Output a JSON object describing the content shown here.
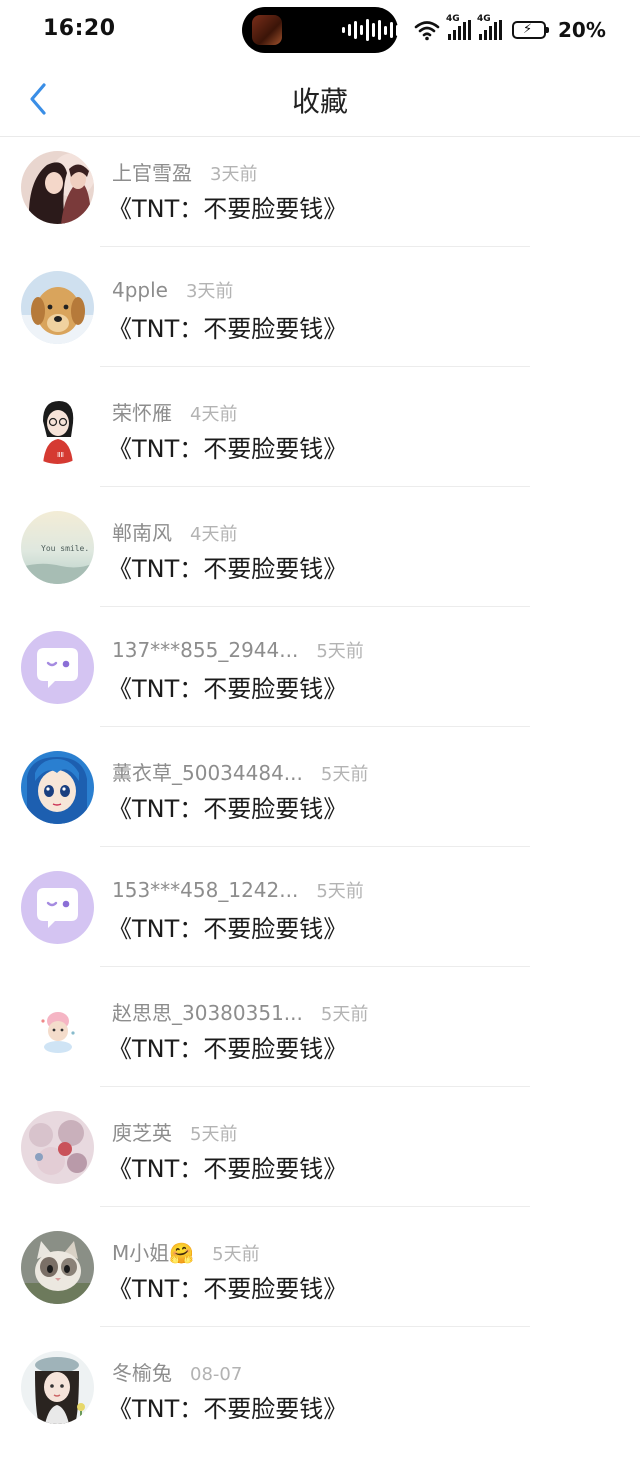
{
  "status_bar": {
    "time": "16:20",
    "network_1": "4G",
    "network_2": "4G",
    "battery": "20%"
  },
  "header": {
    "title": "收藏",
    "back_icon": "chevron-left-icon"
  },
  "colors": {
    "accent": "#3a8ee6",
    "name": "#8d8d8d",
    "time": "#b3b3b3",
    "default_avatar": "#d4c4f2"
  },
  "items": [
    {
      "name": "上官雪盈",
      "time": "3天前",
      "content": "《TNT：不要脸要钱》",
      "avatar": "avatar-couple-art"
    },
    {
      "name": "4pple",
      "time": "3天前",
      "content": "《TNT：不要脸要钱》",
      "avatar": "avatar-golden-dog"
    },
    {
      "name": "荣怀雁",
      "time": "4天前",
      "content": "《TNT：不要脸要钱》",
      "avatar": "avatar-cartoon-girl"
    },
    {
      "name": "郸南风",
      "time": "4天前",
      "content": "《TNT：不要脸要钱》",
      "avatar": "avatar-you-smile"
    },
    {
      "name": "137***855_2944...",
      "time": "5天前",
      "content": "《TNT：不要脸要钱》",
      "avatar": "avatar-default-chat"
    },
    {
      "name": "薰衣草_50034484...",
      "time": "5天前",
      "content": "《TNT：不要脸要钱》",
      "avatar": "avatar-anime-blue"
    },
    {
      "name": "153***458_1242...",
      "time": "5天前",
      "content": "《TNT：不要脸要钱》",
      "avatar": "avatar-default-chat"
    },
    {
      "name": "赵思思_30380351...",
      "time": "5天前",
      "content": "《TNT：不要脸要钱》",
      "avatar": "avatar-baby-sticker"
    },
    {
      "name": "庾芝英",
      "time": "5天前",
      "content": "《TNT：不要脸要钱》",
      "avatar": "avatar-pastel-art"
    },
    {
      "name": "M小姐🤗",
      "time": "5天前",
      "content": "《TNT：不要脸要钱》",
      "avatar": "avatar-cat"
    },
    {
      "name": "冬榆兔",
      "time": "08-07",
      "content": "《TNT：不要脸要钱》",
      "avatar": "avatar-girl-beret"
    }
  ]
}
